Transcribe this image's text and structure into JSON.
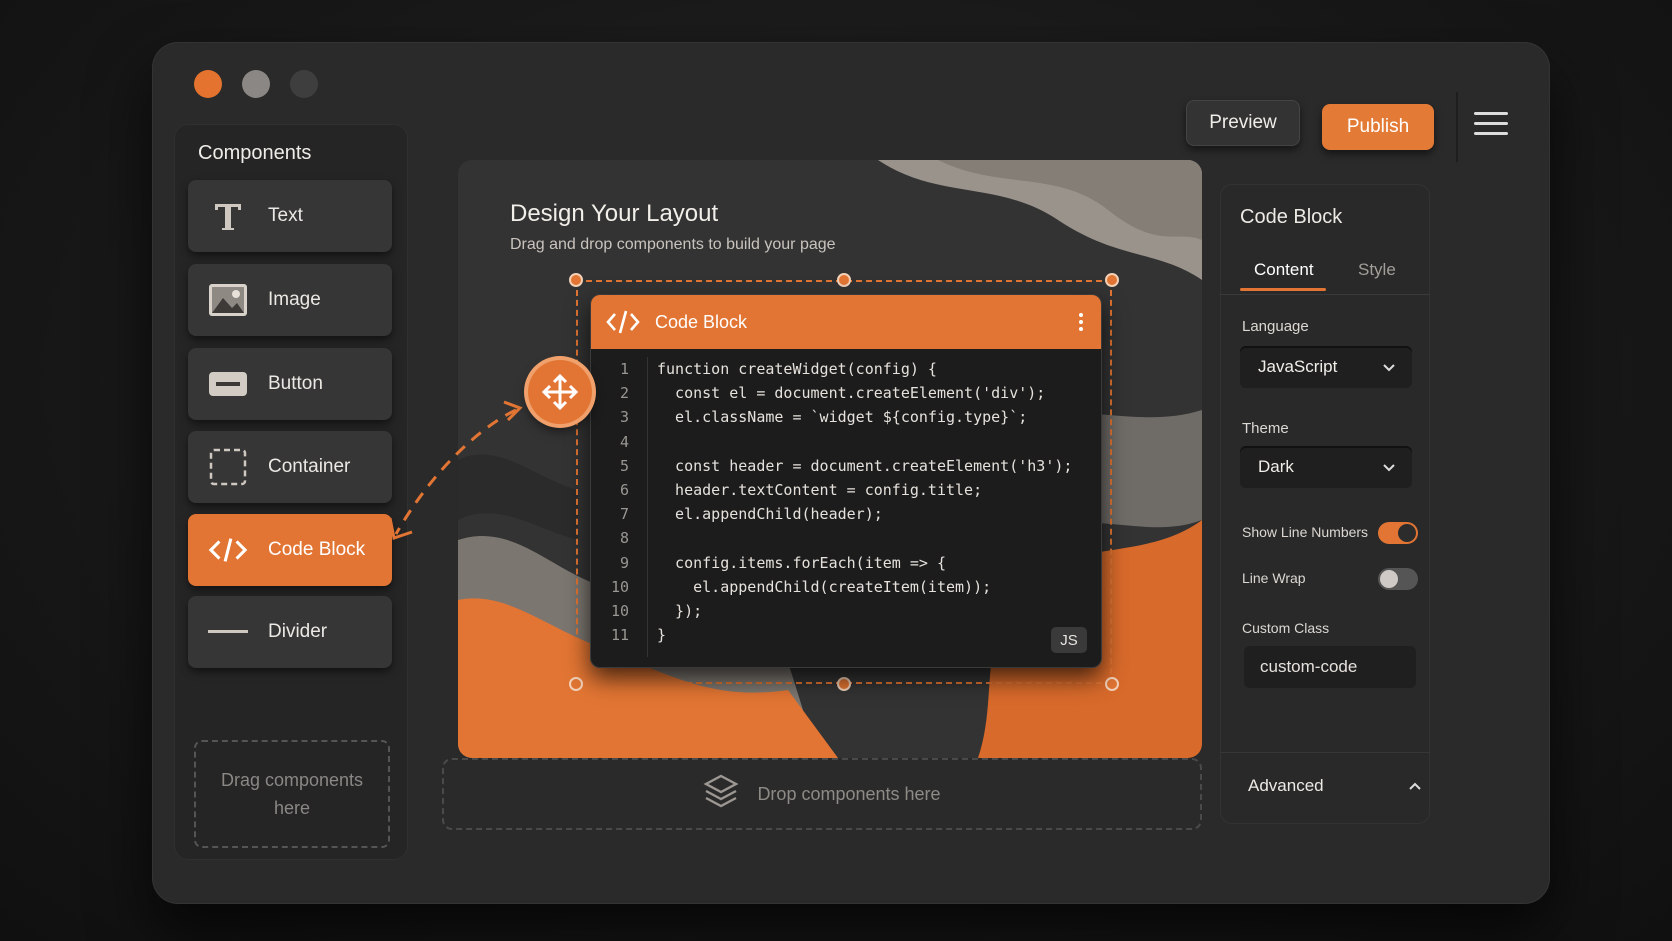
{
  "window": {
    "buttons": {
      "preview": "Preview",
      "publish": "Publish"
    }
  },
  "sidebar": {
    "title": "Components",
    "items": [
      {
        "label": "Text",
        "icon": "text-icon"
      },
      {
        "label": "Image",
        "icon": "image-icon"
      },
      {
        "label": "Button",
        "icon": "button-icon"
      },
      {
        "label": "Container",
        "icon": "container-icon"
      },
      {
        "label": "Code Block",
        "icon": "code-icon",
        "active": true
      },
      {
        "label": "Divider",
        "icon": "divider-icon"
      }
    ],
    "drag_zone": "Drag components here"
  },
  "canvas": {
    "title": "Design Your Layout",
    "subtitle": "Drag and drop components to build your page",
    "drop_zone": "Drop components here",
    "code_block": {
      "title": "Code Block",
      "badge": "JS",
      "line_numbers": [
        "1",
        "2",
        "3",
        "4",
        "5",
        "6",
        "7",
        "8",
        "9",
        "10",
        "10",
        "11"
      ],
      "lines": [
        "function createWidget(config) {",
        "  const el = document.createElement('div');",
        "  el.className = `widget ${config.type}`;",
        "",
        "  const header = document.createElement('h3');",
        "  header.textContent = config.title;",
        "  el.appendChild(header);",
        "",
        "  config.items.forEach(item => {",
        "    el.appendChild(createItem(item));",
        "  });",
        "}"
      ]
    }
  },
  "inspector": {
    "title": "Code Block",
    "tabs": {
      "content": "Content",
      "style": "Style"
    },
    "language_label": "Language",
    "language_value": "JavaScript",
    "theme_label": "Theme",
    "theme_value": "Dark",
    "show_line_numbers_label": "Show Line Numbers",
    "show_line_numbers": true,
    "line_wrap_label": "Line Wrap",
    "line_wrap": false,
    "custom_class_label": "Custom Class",
    "custom_class_value": "custom-code",
    "advanced_label": "Advanced"
  },
  "colors": {
    "accent": "#e27533",
    "background": "#161616",
    "panel": "#2a2a2a"
  }
}
